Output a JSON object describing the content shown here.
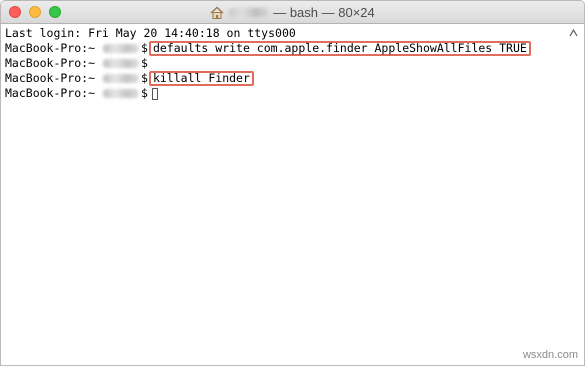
{
  "window": {
    "title_suffix": "— bash — 80×24",
    "icon": "home-icon"
  },
  "terminal": {
    "last_login": "Last login: Fri May 20 14:40:18 on ttys000",
    "prompt_host": "MacBook-Pro:~",
    "prompt_symbol": "$",
    "lines": [
      {
        "command": "defaults write com.apple.finder AppleShowAllFiles TRUE"
      },
      {
        "command": ""
      },
      {
        "command": "killall Finder"
      },
      {
        "command": ""
      }
    ]
  },
  "highlight_color": "#e06c5c",
  "watermark": "wsxdn.com"
}
